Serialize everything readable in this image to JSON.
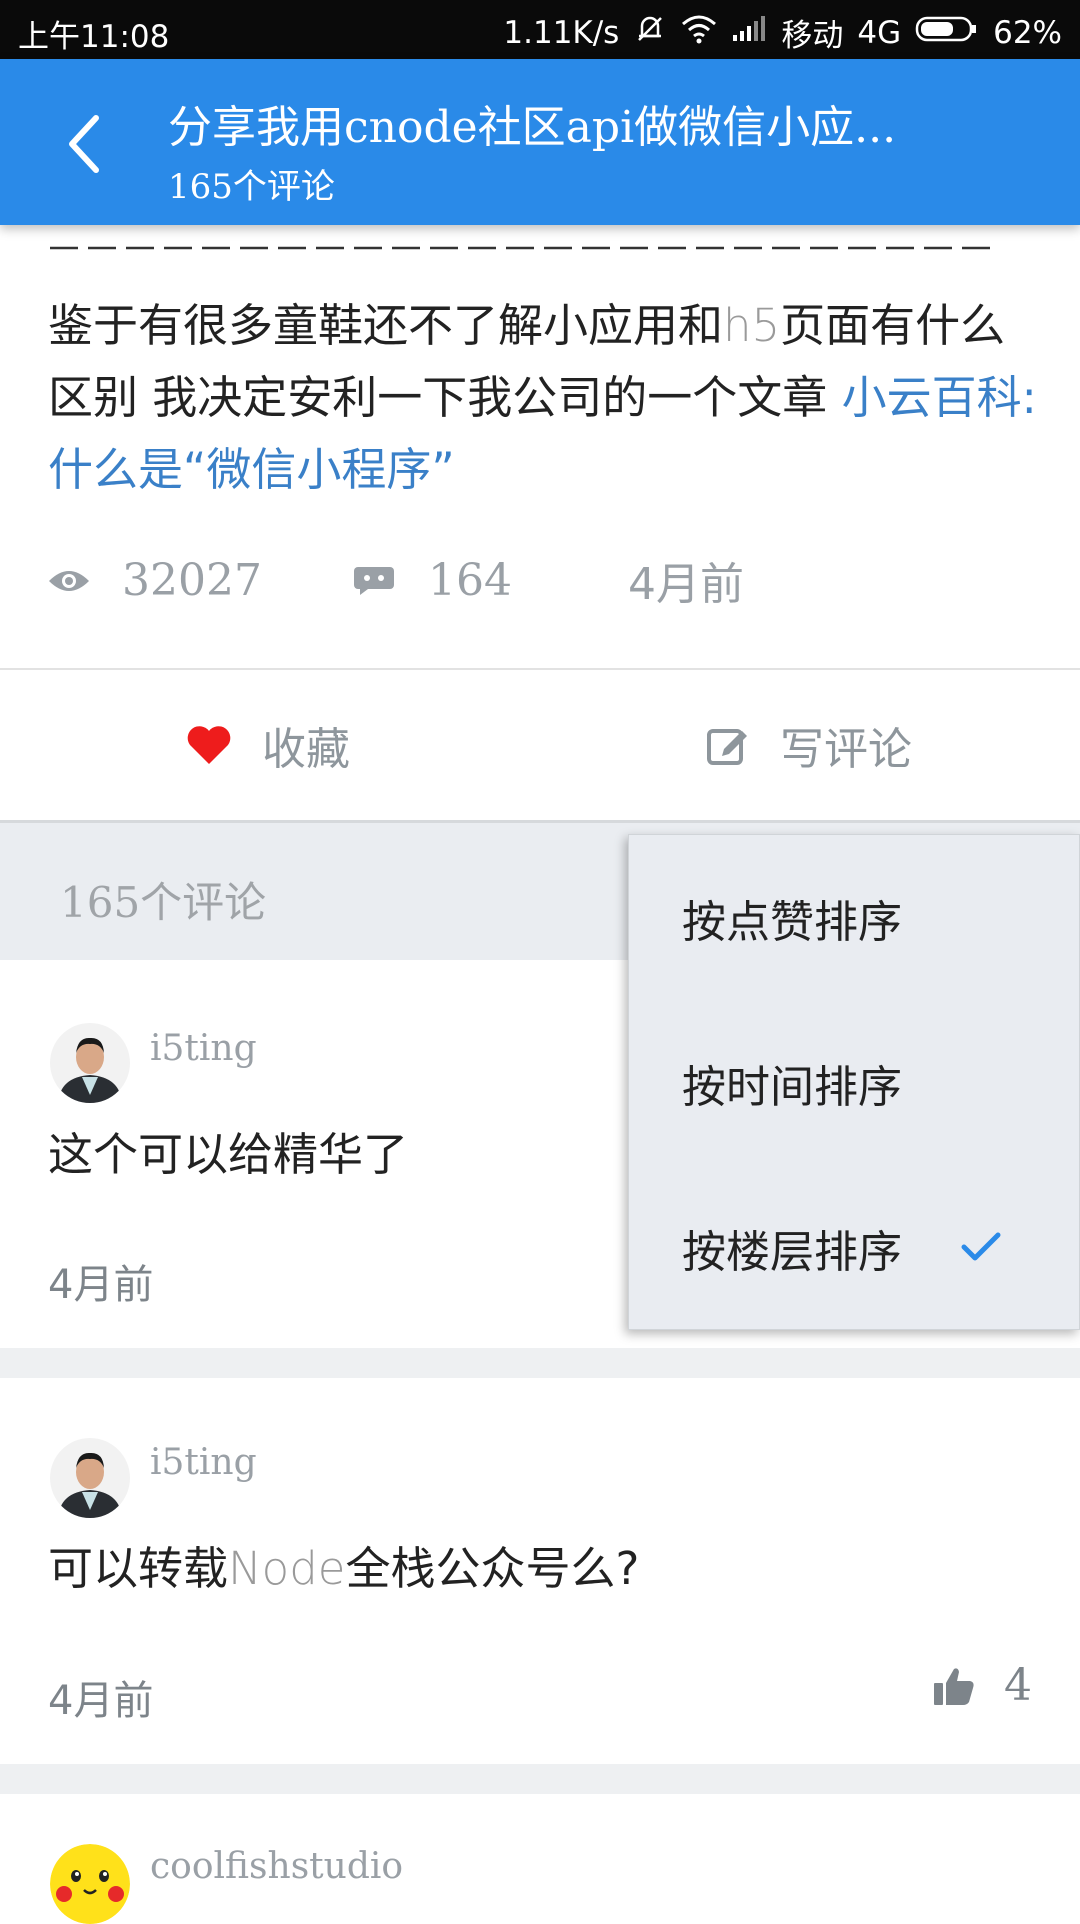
{
  "status_bar": {
    "time": "上午11:08",
    "speed": "1.11K/s",
    "carrier": "移动",
    "network": "4G",
    "battery": "62%",
    "icons": [
      "mute-icon",
      "wifi-icon",
      "signal-icon",
      "battery-icon"
    ]
  },
  "app_bar": {
    "title": "分享我用cnode社区api做微信小应...",
    "subtitle": "165个评论",
    "back_icon": "chevron-left-icon",
    "color": "#2a8ae8"
  },
  "article": {
    "dashes": "— — — — — — — — — — — — — — — — — — — — — — — — — — — —",
    "body_part1": "鉴于有很多童鞋还不了解小应用和",
    "body_light": "h5",
    "body_part2": "页面有什么区别 我决定安利一下我公司的一个文章 ",
    "link_text": "小云百科:什么是“微信小程序”",
    "views": "32027",
    "replies": "164",
    "time": "4月前"
  },
  "actions": {
    "favorite_label": "收藏",
    "comment_label": "写评论",
    "favorite_icon": "heart-icon",
    "comment_icon": "edit-icon",
    "heart_color": "#ee1c1c"
  },
  "comments_header": {
    "count_label": "165个评论"
  },
  "sort_menu": {
    "items": [
      {
        "label": "按点赞排序",
        "selected": false
      },
      {
        "label": "按时间排序",
        "selected": false
      },
      {
        "label": "按楼层排序",
        "selected": true
      }
    ],
    "check_color": "#2a8ae8"
  },
  "comments": [
    {
      "author": "i5ting",
      "text": "这个可以给精华了",
      "time": "4月前",
      "likes": ""
    },
    {
      "author": "i5ting",
      "text_part1": "可以转载",
      "text_light": "Node",
      "text_part2": "全栈公众号么?",
      "time": "4月前",
      "likes": "4"
    },
    {
      "author": "coolfishstudio"
    }
  ]
}
